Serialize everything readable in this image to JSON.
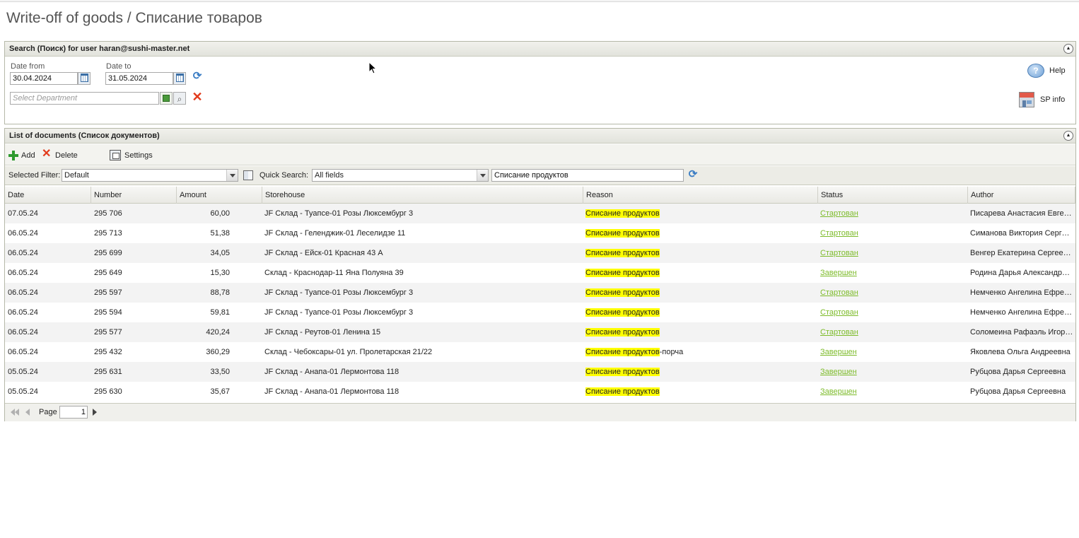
{
  "page": {
    "title": "Write-off of goods / Списание товаров"
  },
  "search_panel": {
    "title": "Search (Поиск) for user haran@sushi-master.net",
    "date_from_label": "Date from",
    "date_from_value": "30.04.2024",
    "date_to_label": "Date to",
    "date_to_value": "31.05.2024",
    "department_placeholder": "Select Department",
    "help_label": "Help",
    "sp_info_label": "SP info"
  },
  "list_panel": {
    "title": "List of documents (Список документов)",
    "toolbar": {
      "add_label": "Add",
      "delete_label": "Delete",
      "settings_label": "Settings"
    },
    "filterbar": {
      "selected_filter_label": "Selected Filter:",
      "selected_filter_value": "Default",
      "quick_search_label": "Quick Search:",
      "quick_search_scope": "All fields",
      "quick_search_value": "Списание продуктов"
    },
    "columns": [
      "Date",
      "Number",
      "Amount",
      "Storehouse",
      "Reason",
      "Status",
      "Author"
    ],
    "rows": [
      {
        "date": "07.05.24",
        "number": "295 706",
        "amount": "60,00",
        "storehouse": "JF Склад - Туапсе-01 Розы Люксембург 3",
        "reason_hl": "Списание продуктов",
        "reason_rest": "",
        "status": "Стартован",
        "author": "Писарева Анастасия Евгеньевна"
      },
      {
        "date": "06.05.24",
        "number": "295 713",
        "amount": "51,38",
        "storehouse": "JF Склад - Геленджик-01 Леселидзе 11",
        "reason_hl": "Списание продуктов",
        "reason_rest": "",
        "status": "Стартован",
        "author": "Симанова Виктория Сергеевна"
      },
      {
        "date": "06.05.24",
        "number": "295 699",
        "amount": "34,05",
        "storehouse": "JF Склад - Ейск-01 Красная 43 А",
        "reason_hl": "Списание продуктов",
        "reason_rest": "",
        "status": "Стартован",
        "author": "Венгер Екатерина Сергеевна"
      },
      {
        "date": "06.05.24",
        "number": "295 649",
        "amount": "15,30",
        "storehouse": "Склад - Краснодар-11 Яна Полуяна 39",
        "reason_hl": "Списание продуктов",
        "reason_rest": "",
        "status": "Завершен",
        "author": "Родина Дарья Александровна"
      },
      {
        "date": "06.05.24",
        "number": "295 597",
        "amount": "88,78",
        "storehouse": "JF Склад - Туапсе-01 Розы Люксембург 3",
        "reason_hl": "Списание продуктов",
        "reason_rest": "",
        "status": "Стартован",
        "author": "Немченко Ангелина Ефремовна"
      },
      {
        "date": "06.05.24",
        "number": "295 594",
        "amount": "59,81",
        "storehouse": "JF Склад - Туапсе-01 Розы Люксембург 3",
        "reason_hl": "Списание продуктов",
        "reason_rest": "",
        "status": "Стартован",
        "author": "Немченко Ангелина Ефремовна"
      },
      {
        "date": "06.05.24",
        "number": "295 577",
        "amount": "420,24",
        "storehouse": "JF Склад - Реутов-01 Ленина 15",
        "reason_hl": "Списание продуктов",
        "reason_rest": "",
        "status": "Стартован",
        "author": "Соломеина Рафаэль Игоревич"
      },
      {
        "date": "06.05.24",
        "number": "295 432",
        "amount": "360,29",
        "storehouse": "Склад - Чебоксары-01 ул. Пролетарская 21/22",
        "reason_hl": "Списание продуктов",
        "reason_rest": "-порча",
        "status": "Завершен",
        "author": "Яковлева Ольга Андреевна"
      },
      {
        "date": "05.05.24",
        "number": "295 631",
        "amount": "33,50",
        "storehouse": "JF Склад - Анапа-01 Лермонтова 118",
        "reason_hl": "Списание продуктов",
        "reason_rest": "",
        "status": "Завершен",
        "author": "Рубцова Дарья Сергеевна"
      },
      {
        "date": "05.05.24",
        "number": "295 630",
        "amount": "35,67",
        "storehouse": "JF Склад - Анапа-01 Лермонтова 118",
        "reason_hl": "Списание продуктов",
        "reason_rest": "",
        "status": "Завершен",
        "author": "Рубцова Дарья Сергеевна"
      }
    ],
    "pager": {
      "page_label": "Page",
      "page_value": "1"
    }
  },
  "colors": {
    "highlight": "#ffff00",
    "status_link": "#7dbb2a",
    "panel_border": "#b5b8a8"
  }
}
